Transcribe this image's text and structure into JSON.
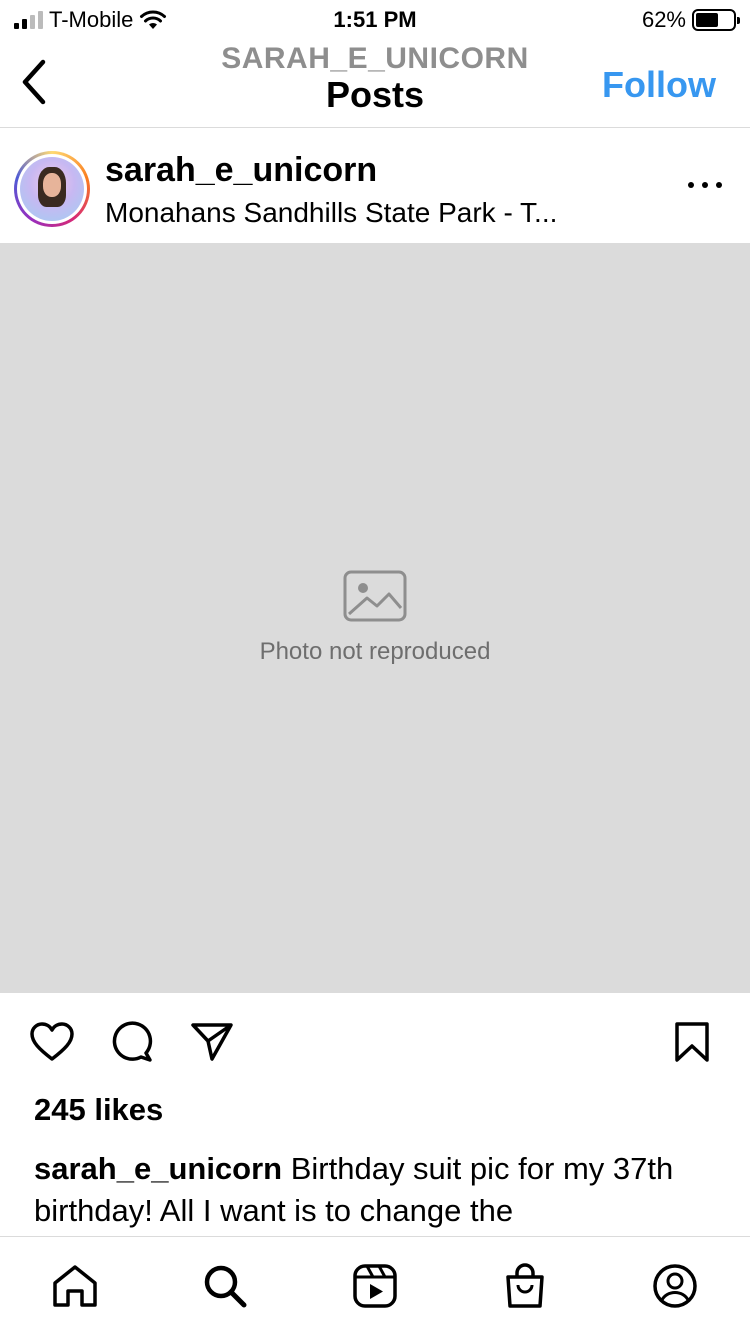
{
  "status_bar": {
    "carrier": "T-Mobile",
    "time": "1:51 PM",
    "battery_text": "62%",
    "battery_level": 0.62,
    "icons": [
      "signal-icon",
      "wifi-icon",
      "battery-icon"
    ]
  },
  "nav": {
    "subtitle": "SARAH_E_UNICORN",
    "title": "Posts",
    "follow_label": "Follow"
  },
  "post": {
    "username": "sarah_e_unicorn",
    "location": "Monahans Sandhills State Park - T...",
    "photo_note": "Photo not reproduced"
  },
  "engagement": {
    "likes": "245 likes",
    "caption_user": "sarah_e_unicorn",
    "caption_text": " Birthday suit pic for my 37th birthday! All I want is to change the"
  },
  "colors": {
    "accent": "#3797f0",
    "muted": "#8e8e8e",
    "divider": "#dbdbdb"
  },
  "tabbar": {
    "icons": [
      "home-icon",
      "search-icon",
      "reels-icon",
      "shop-icon",
      "profile-icon"
    ]
  }
}
